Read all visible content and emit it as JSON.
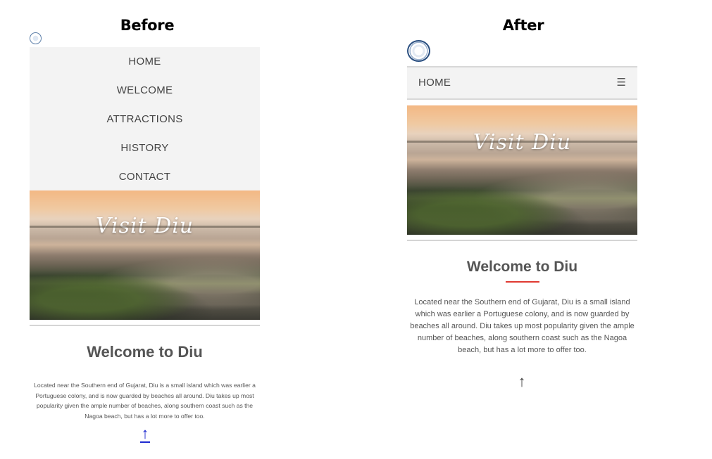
{
  "labels": {
    "before": "Before",
    "after": "After"
  },
  "before": {
    "nav": [
      "HOME",
      "WELCOME",
      "ATTRACTIONS",
      "HISTORY",
      "CONTACT"
    ],
    "hero_text": "Visit Diu",
    "heading": "Welcome to Diu",
    "paragraph": "Located near the Southern end of Gujarat, Diu is a small island which was earlier a Portuguese colony, and is now guarded by beaches all around. Diu takes up most popularity given the ample number of beaches, along southern coast such as the Nagoa beach, but has a lot more to offer too.",
    "back_to_top": "↑"
  },
  "after": {
    "nav_home": "HOME",
    "menu_icon": "☰",
    "hero_text": "Visit Diu",
    "heading": "Welcome to Diu",
    "paragraph": "Located near the Southern end of Gujarat, Diu is a small island which was earlier a Portuguese colony, and is now guarded by beaches all around. Diu takes up most popularity given the ample number of beaches, along southern coast such as the Nagoa beach, but has a lot more to offer too.",
    "back_to_top": "↑"
  },
  "colors": {
    "accent_underline": "#e03a32",
    "nav_bg": "#f3f3f3",
    "link_blue": "#1f2bd0"
  },
  "icons": {
    "logo": "seal-logo-icon",
    "menu": "hamburger-icon",
    "back_to_top": "arrow-up-icon"
  }
}
